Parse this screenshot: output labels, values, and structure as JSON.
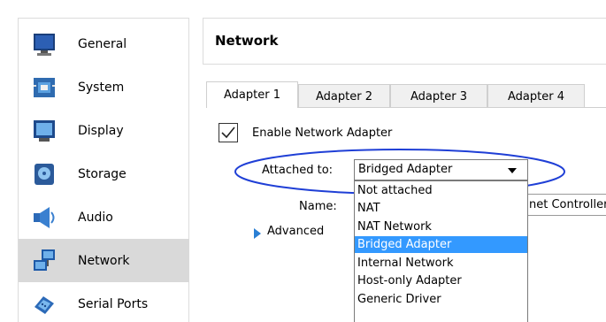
{
  "sidebar": {
    "items": [
      {
        "label": "General",
        "icon": "monitor-icon"
      },
      {
        "label": "System",
        "icon": "chip-icon"
      },
      {
        "label": "Display",
        "icon": "display-icon"
      },
      {
        "label": "Storage",
        "icon": "disc-icon"
      },
      {
        "label": "Audio",
        "icon": "speaker-icon"
      },
      {
        "label": "Network",
        "icon": "network-icon"
      },
      {
        "label": "Serial Ports",
        "icon": "serial-port-icon"
      }
    ],
    "selected": "Network"
  },
  "header": {
    "title": "Network"
  },
  "tabs": [
    {
      "label": "Adapter 1"
    },
    {
      "label": "Adapter 2"
    },
    {
      "label": "Adapter 3"
    },
    {
      "label": "Adapter 4"
    }
  ],
  "enable_checkbox": {
    "label": "Enable Network Adapter",
    "checked": true
  },
  "attached_to": {
    "label": "Attached to:",
    "value": "Bridged Adapter",
    "options": [
      "Not attached",
      "NAT",
      "NAT Network",
      "Bridged Adapter",
      "Internal Network",
      "Host-only Adapter",
      "Generic Driver"
    ]
  },
  "name": {
    "label": "Name:",
    "value_partial": "net Controller"
  },
  "advanced": {
    "label": "Advanced"
  },
  "colors": {
    "selection": "#3399ff",
    "annotation": "#1f3fd6",
    "sidebar_selected": "#d9d9d9"
  }
}
